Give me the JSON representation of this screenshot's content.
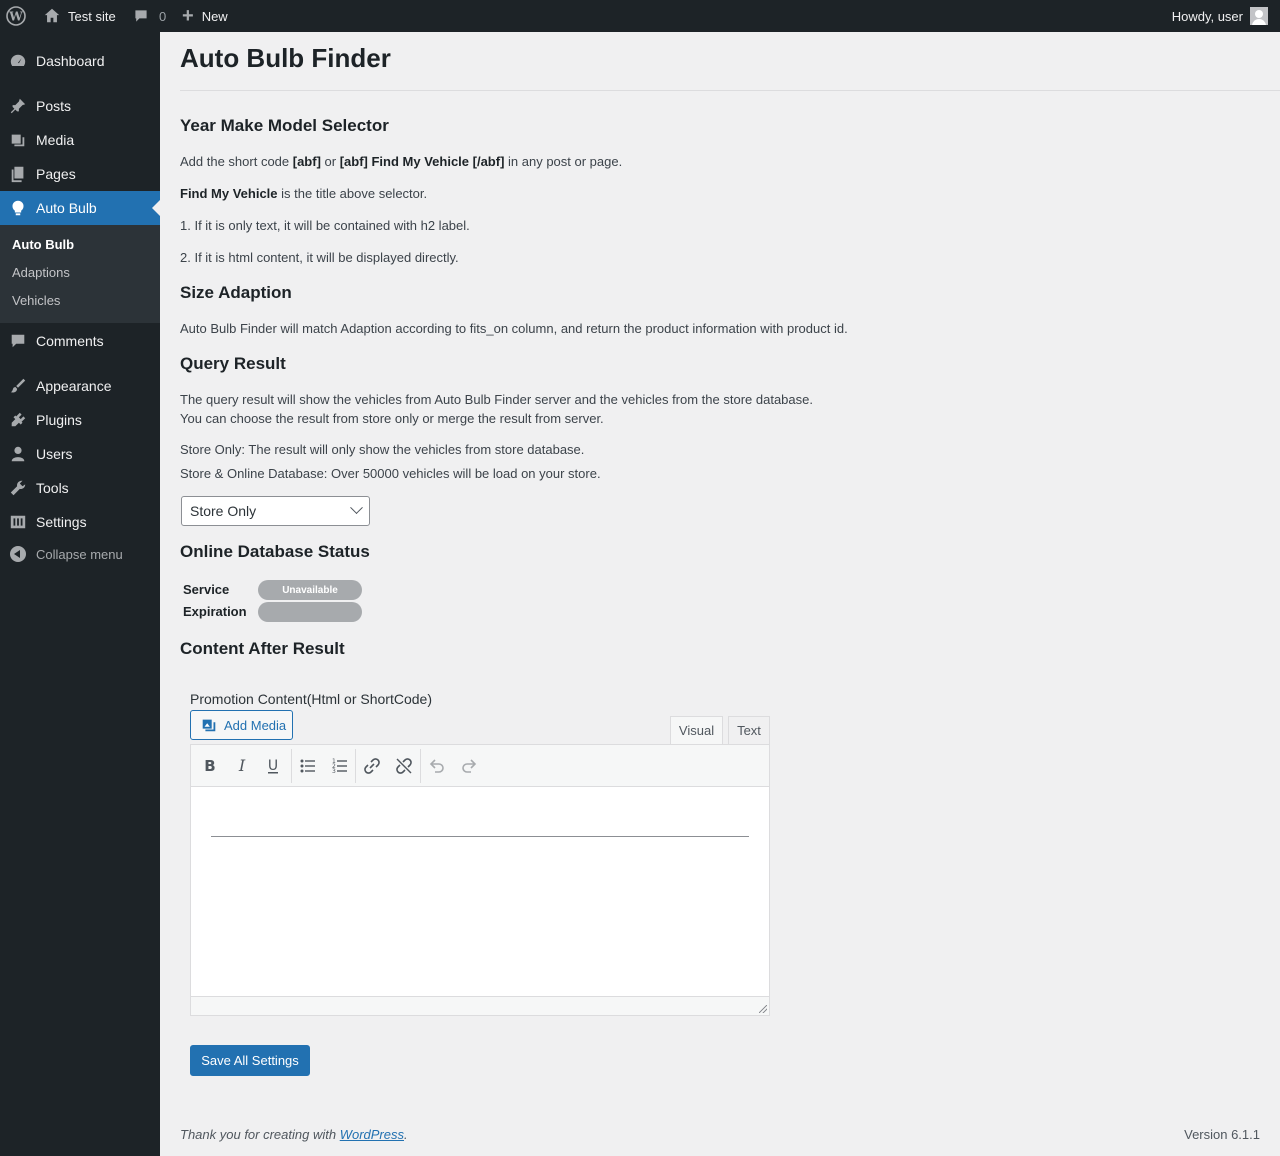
{
  "adminbar": {
    "site_name": "Test site",
    "comments_count": "0",
    "new_label": "New",
    "howdy": "Howdy, user"
  },
  "sidebar": {
    "items": [
      {
        "label": "Dashboard",
        "icon": "dashboard-icon"
      },
      {
        "label": "Posts",
        "icon": "pin-icon"
      },
      {
        "label": "Media",
        "icon": "media-icon"
      },
      {
        "label": "Pages",
        "icon": "pages-icon"
      },
      {
        "label": "Auto Bulb",
        "icon": "lightbulb-icon"
      },
      {
        "label": "Comments",
        "icon": "comment-icon"
      },
      {
        "label": "Appearance",
        "icon": "brush-icon"
      },
      {
        "label": "Plugins",
        "icon": "plugin-icon"
      },
      {
        "label": "Users",
        "icon": "user-icon"
      },
      {
        "label": "Tools",
        "icon": "wrench-icon"
      },
      {
        "label": "Settings",
        "icon": "settings-icon"
      }
    ],
    "submenu": [
      "Auto Bulb",
      "Adaptions",
      "Vehicles"
    ],
    "collapse_label": "Collapse menu"
  },
  "page": {
    "title": "Auto Bulb Finder",
    "ymm": {
      "heading": "Year Make Model Selector",
      "p1_a": "Add the short code ",
      "p1_code1": "[abf]",
      "p1_or": " or ",
      "p1_code2": "[abf] Find My Vehicle [/abf]",
      "p1_b": " in any post or page.",
      "p2_bold": "Find My Vehicle",
      "p2_rest": " is the title above selector.",
      "p3": "1. If it is only text, it will be contained with h2 label.",
      "p4": "2. If it is html content, it will be displayed directly."
    },
    "size": {
      "heading": "Size Adaption",
      "p1": "Auto Bulb Finder will match Adaption according to fits_on column, and return the product information with product id."
    },
    "query": {
      "heading": "Query Result",
      "p1": "The query result will show the vehicles from Auto Bulb Finder server and the vehicles from the store database.",
      "p2": "You can choose the result from store only or merge the result from server.",
      "p3": "Store Only: The result will only show the vehicles from store database.",
      "p4": "Store & Online Database: Over 50000 vehicles will be load on your store.",
      "select_value": "Store Only"
    },
    "status": {
      "heading": "Online Database Status",
      "service_label": "Service",
      "service_value": "Unavailable",
      "expiration_label": "Expiration",
      "expiration_value": ""
    },
    "content_after": {
      "heading": "Content After Result",
      "promo_label": "Promotion Content(Html or ShortCode)",
      "add_media": "Add Media",
      "tab_visual": "Visual",
      "tab_text": "Text"
    },
    "save_label": "Save All Settings"
  },
  "footer": {
    "thanks_a": "Thank you for creating with ",
    "link": "WordPress",
    "thanks_b": ".",
    "version": "Version 6.1.1"
  },
  "colors": {
    "accent": "#2271b1",
    "sidebar_bg": "#1d2327",
    "status_pill": "#a7aaad"
  }
}
